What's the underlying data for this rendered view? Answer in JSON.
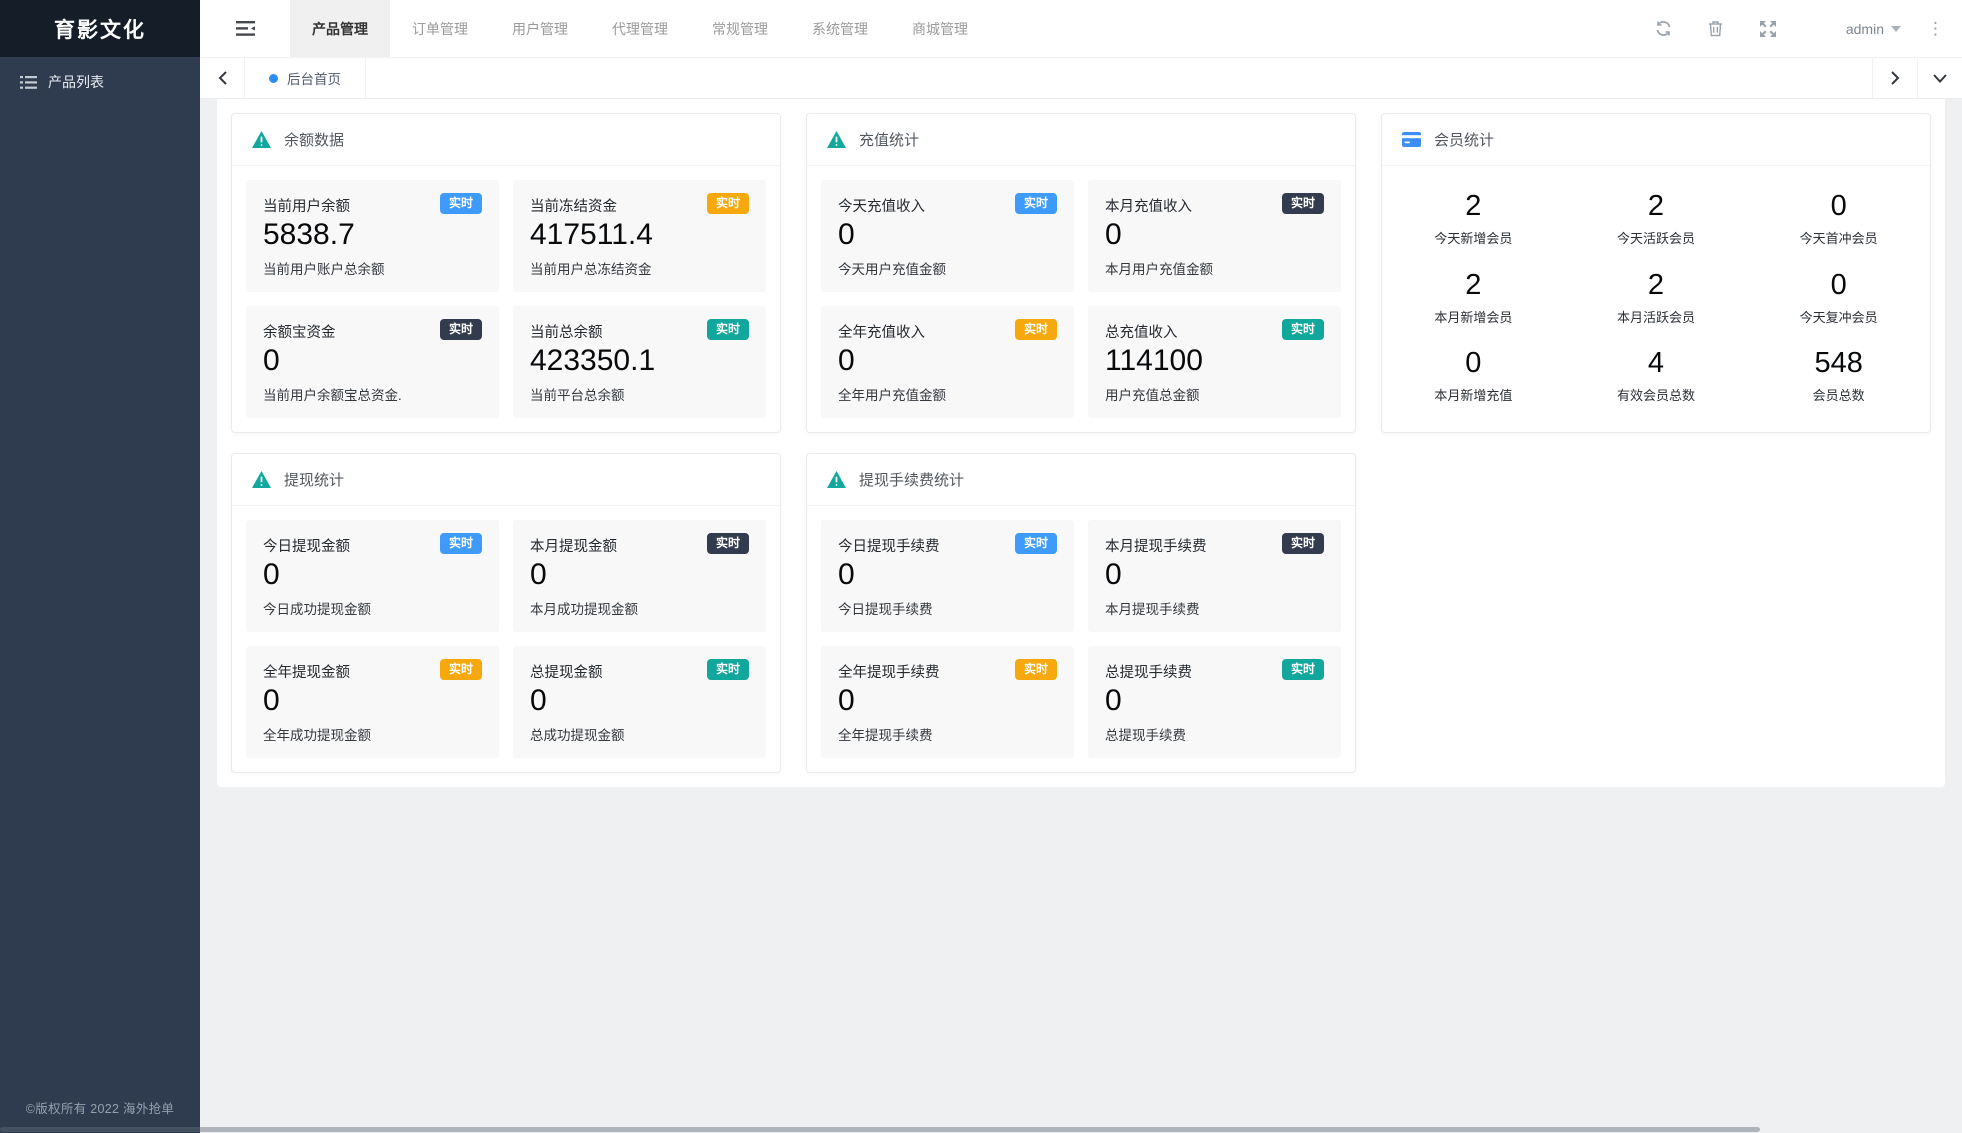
{
  "sidebar": {
    "logo": "育影文化",
    "items": [
      {
        "label": "产品列表",
        "icon": "list"
      }
    ],
    "footer": "©版权所有 2022 海外抢单"
  },
  "header": {
    "tabs": [
      {
        "label": "产品管理",
        "active": true
      },
      {
        "label": "订单管理",
        "active": false
      },
      {
        "label": "用户管理",
        "active": false
      },
      {
        "label": "代理管理",
        "active": false
      },
      {
        "label": "常规管理",
        "active": false
      },
      {
        "label": "系统管理",
        "active": false
      },
      {
        "label": "商城管理",
        "active": false
      }
    ],
    "icons": [
      "refresh",
      "trash",
      "fullscreen"
    ],
    "user": "admin",
    "kebab": "⋮"
  },
  "tabbar": {
    "tabs": [
      {
        "label": "后台首页",
        "active": true
      }
    ]
  },
  "badge_label": "实时",
  "colors": {
    "badge_blue": "#3e9bfa",
    "badge_dark": "#333c4e",
    "badge_orange": "#f7a80d",
    "badge_teal": "#12a79c",
    "warning_icon": "#13a89e",
    "card_icon": "#3e8ef7",
    "tab_dot": "#2d8cf0"
  },
  "cards": [
    {
      "id": "balance",
      "title": "余额数据",
      "icon": "warning",
      "stats": [
        {
          "label": "当前用户余额",
          "value": "5838.7",
          "desc": "当前用户账户总余额",
          "badge": "blue"
        },
        {
          "label": "当前冻结资金",
          "value": "417511.4",
          "desc": "当前用户总冻结资金",
          "badge": "orange"
        },
        {
          "label": "余额宝资金",
          "value": "0",
          "desc": "当前用户余额宝总资金.",
          "badge": "dark"
        },
        {
          "label": "当前总余额",
          "value": "423350.1",
          "desc": "当前平台总余额",
          "badge": "teal"
        }
      ]
    },
    {
      "id": "recharge",
      "title": "充值统计",
      "icon": "warning",
      "stats": [
        {
          "label": "今天充值收入",
          "value": "0",
          "desc": "今天用户充值金额",
          "badge": "blue"
        },
        {
          "label": "本月充值收入",
          "value": "0",
          "desc": "本月用户充值金额",
          "badge": "dark"
        },
        {
          "label": "全年充值收入",
          "value": "0",
          "desc": "全年用户充值金额",
          "badge": "orange"
        },
        {
          "label": "总充值收入",
          "value": "114100",
          "desc": "用户充值总金额",
          "badge": "teal"
        }
      ]
    },
    {
      "id": "member",
      "title": "会员统计",
      "icon": "credit-card",
      "grid": [
        {
          "value": "2",
          "label": "今天新增会员"
        },
        {
          "value": "2",
          "label": "今天活跃会员"
        },
        {
          "value": "0",
          "label": "今天首冲会员"
        },
        {
          "value": "2",
          "label": "本月新增会员"
        },
        {
          "value": "2",
          "label": "本月活跃会员"
        },
        {
          "value": "0",
          "label": "今天复冲会员"
        },
        {
          "value": "0",
          "label": "本月新增充值"
        },
        {
          "value": "4",
          "label": "有效会员总数"
        },
        {
          "value": "548",
          "label": "会员总数"
        }
      ]
    },
    {
      "id": "withdraw",
      "title": "提现统计",
      "icon": "warning",
      "stats": [
        {
          "label": "今日提现金额",
          "value": "0",
          "desc": "今日成功提现金额",
          "badge": "blue"
        },
        {
          "label": "本月提现金额",
          "value": "0",
          "desc": "本月成功提现金额",
          "badge": "dark"
        },
        {
          "label": "全年提现金额",
          "value": "0",
          "desc": "全年成功提现金额",
          "badge": "orange"
        },
        {
          "label": "总提现金额",
          "value": "0",
          "desc": "总成功提现金额",
          "badge": "teal"
        }
      ]
    },
    {
      "id": "fee",
      "title": "提现手续费统计",
      "icon": "warning",
      "stats": [
        {
          "label": "今日提现手续费",
          "value": "0",
          "desc": "今日提现手续费",
          "badge": "blue"
        },
        {
          "label": "本月提现手续费",
          "value": "0",
          "desc": "本月提现手续费",
          "badge": "dark"
        },
        {
          "label": "全年提现手续费",
          "value": "0",
          "desc": "全年提现手续费",
          "badge": "orange"
        },
        {
          "label": "总提现手续费",
          "value": "0",
          "desc": "总提现手续费",
          "badge": "teal"
        }
      ]
    }
  ]
}
